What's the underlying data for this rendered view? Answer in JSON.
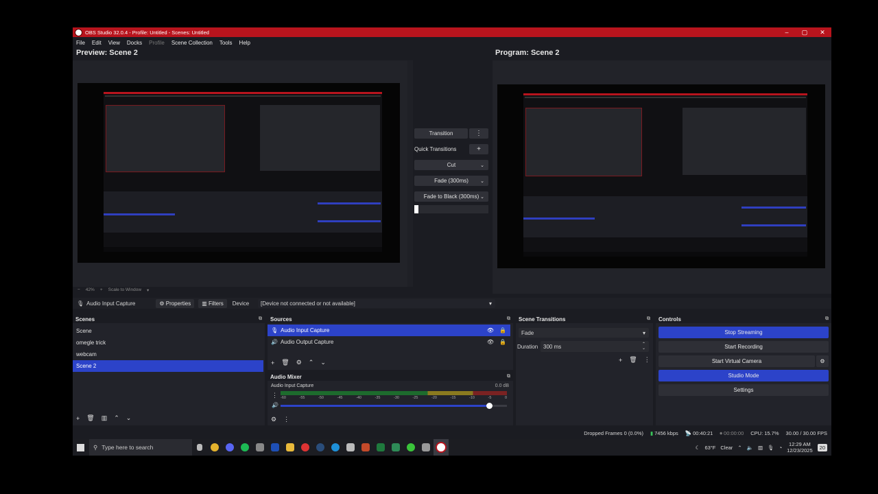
{
  "window": {
    "title": "OBS Studio 32.0.4 - Profile: Untitled - Scenes: Untitled"
  },
  "menu": [
    "File",
    "Edit",
    "View",
    "Docks",
    "Profile",
    "Scene Collection",
    "Tools",
    "Help"
  ],
  "preview_label": "Preview: Scene 2",
  "program_label": "Program: Scene 2",
  "transitions": {
    "transition": "Transition",
    "quick": "Quick Transitions",
    "cut": "Cut",
    "fade": "Fade (300ms)",
    "fade_black": "Fade to Black (300ms)"
  },
  "zoom": {
    "level": "42%",
    "scale": "Scale to Window"
  },
  "props_bar": {
    "source": "Audio Input Capture",
    "properties": "Properties",
    "filters": "Filters",
    "device_label": "Device",
    "device_value": "[Device not connected or not available]"
  },
  "scenes": {
    "title": "Scenes",
    "items": [
      "Scene",
      "omegle trick",
      "webcam",
      "Scene 2"
    ],
    "selected": "Scene 2"
  },
  "sources": {
    "title": "Sources",
    "items": [
      "Audio Input Capture",
      "Audio Output Capture"
    ]
  },
  "mixer": {
    "title": "Audio Mixer",
    "channel": "Audio Input Capture",
    "db": "0.0 dB",
    "ticks": [
      "-60",
      "-55",
      "-50",
      "-45",
      "-40",
      "-35",
      "-30",
      "-25",
      "-20",
      "-15",
      "-10",
      "-5",
      "0"
    ],
    "level": 0.92
  },
  "scene_transitions": {
    "title": "Scene Transitions",
    "type": "Fade",
    "duration_label": "Duration",
    "duration": "300 ms"
  },
  "controls": {
    "title": "Controls",
    "stop_streaming": "Stop Streaming",
    "start_recording": "Start Recording",
    "start_virtual_camera": "Start Virtual Camera",
    "studio_mode": "Studio Mode",
    "settings": "Settings"
  },
  "status": {
    "dropped": "Dropped Frames 0 (0.0%)",
    "bitrate": "7456 kbps",
    "stream_time": "00:40:21",
    "rec_time": "00:00:00",
    "cpu": "CPU: 15.7%",
    "fps": "30.00 / 30.00 FPS"
  },
  "taskbar": {
    "search": "Type here to search",
    "weather_temp": "63°F",
    "weather": "Clear",
    "time": "12:29 AM",
    "date": "12/23/2025",
    "notifications": "20"
  },
  "colors": {
    "accent": "#2c43c9",
    "titlebar": "#b8141d"
  }
}
